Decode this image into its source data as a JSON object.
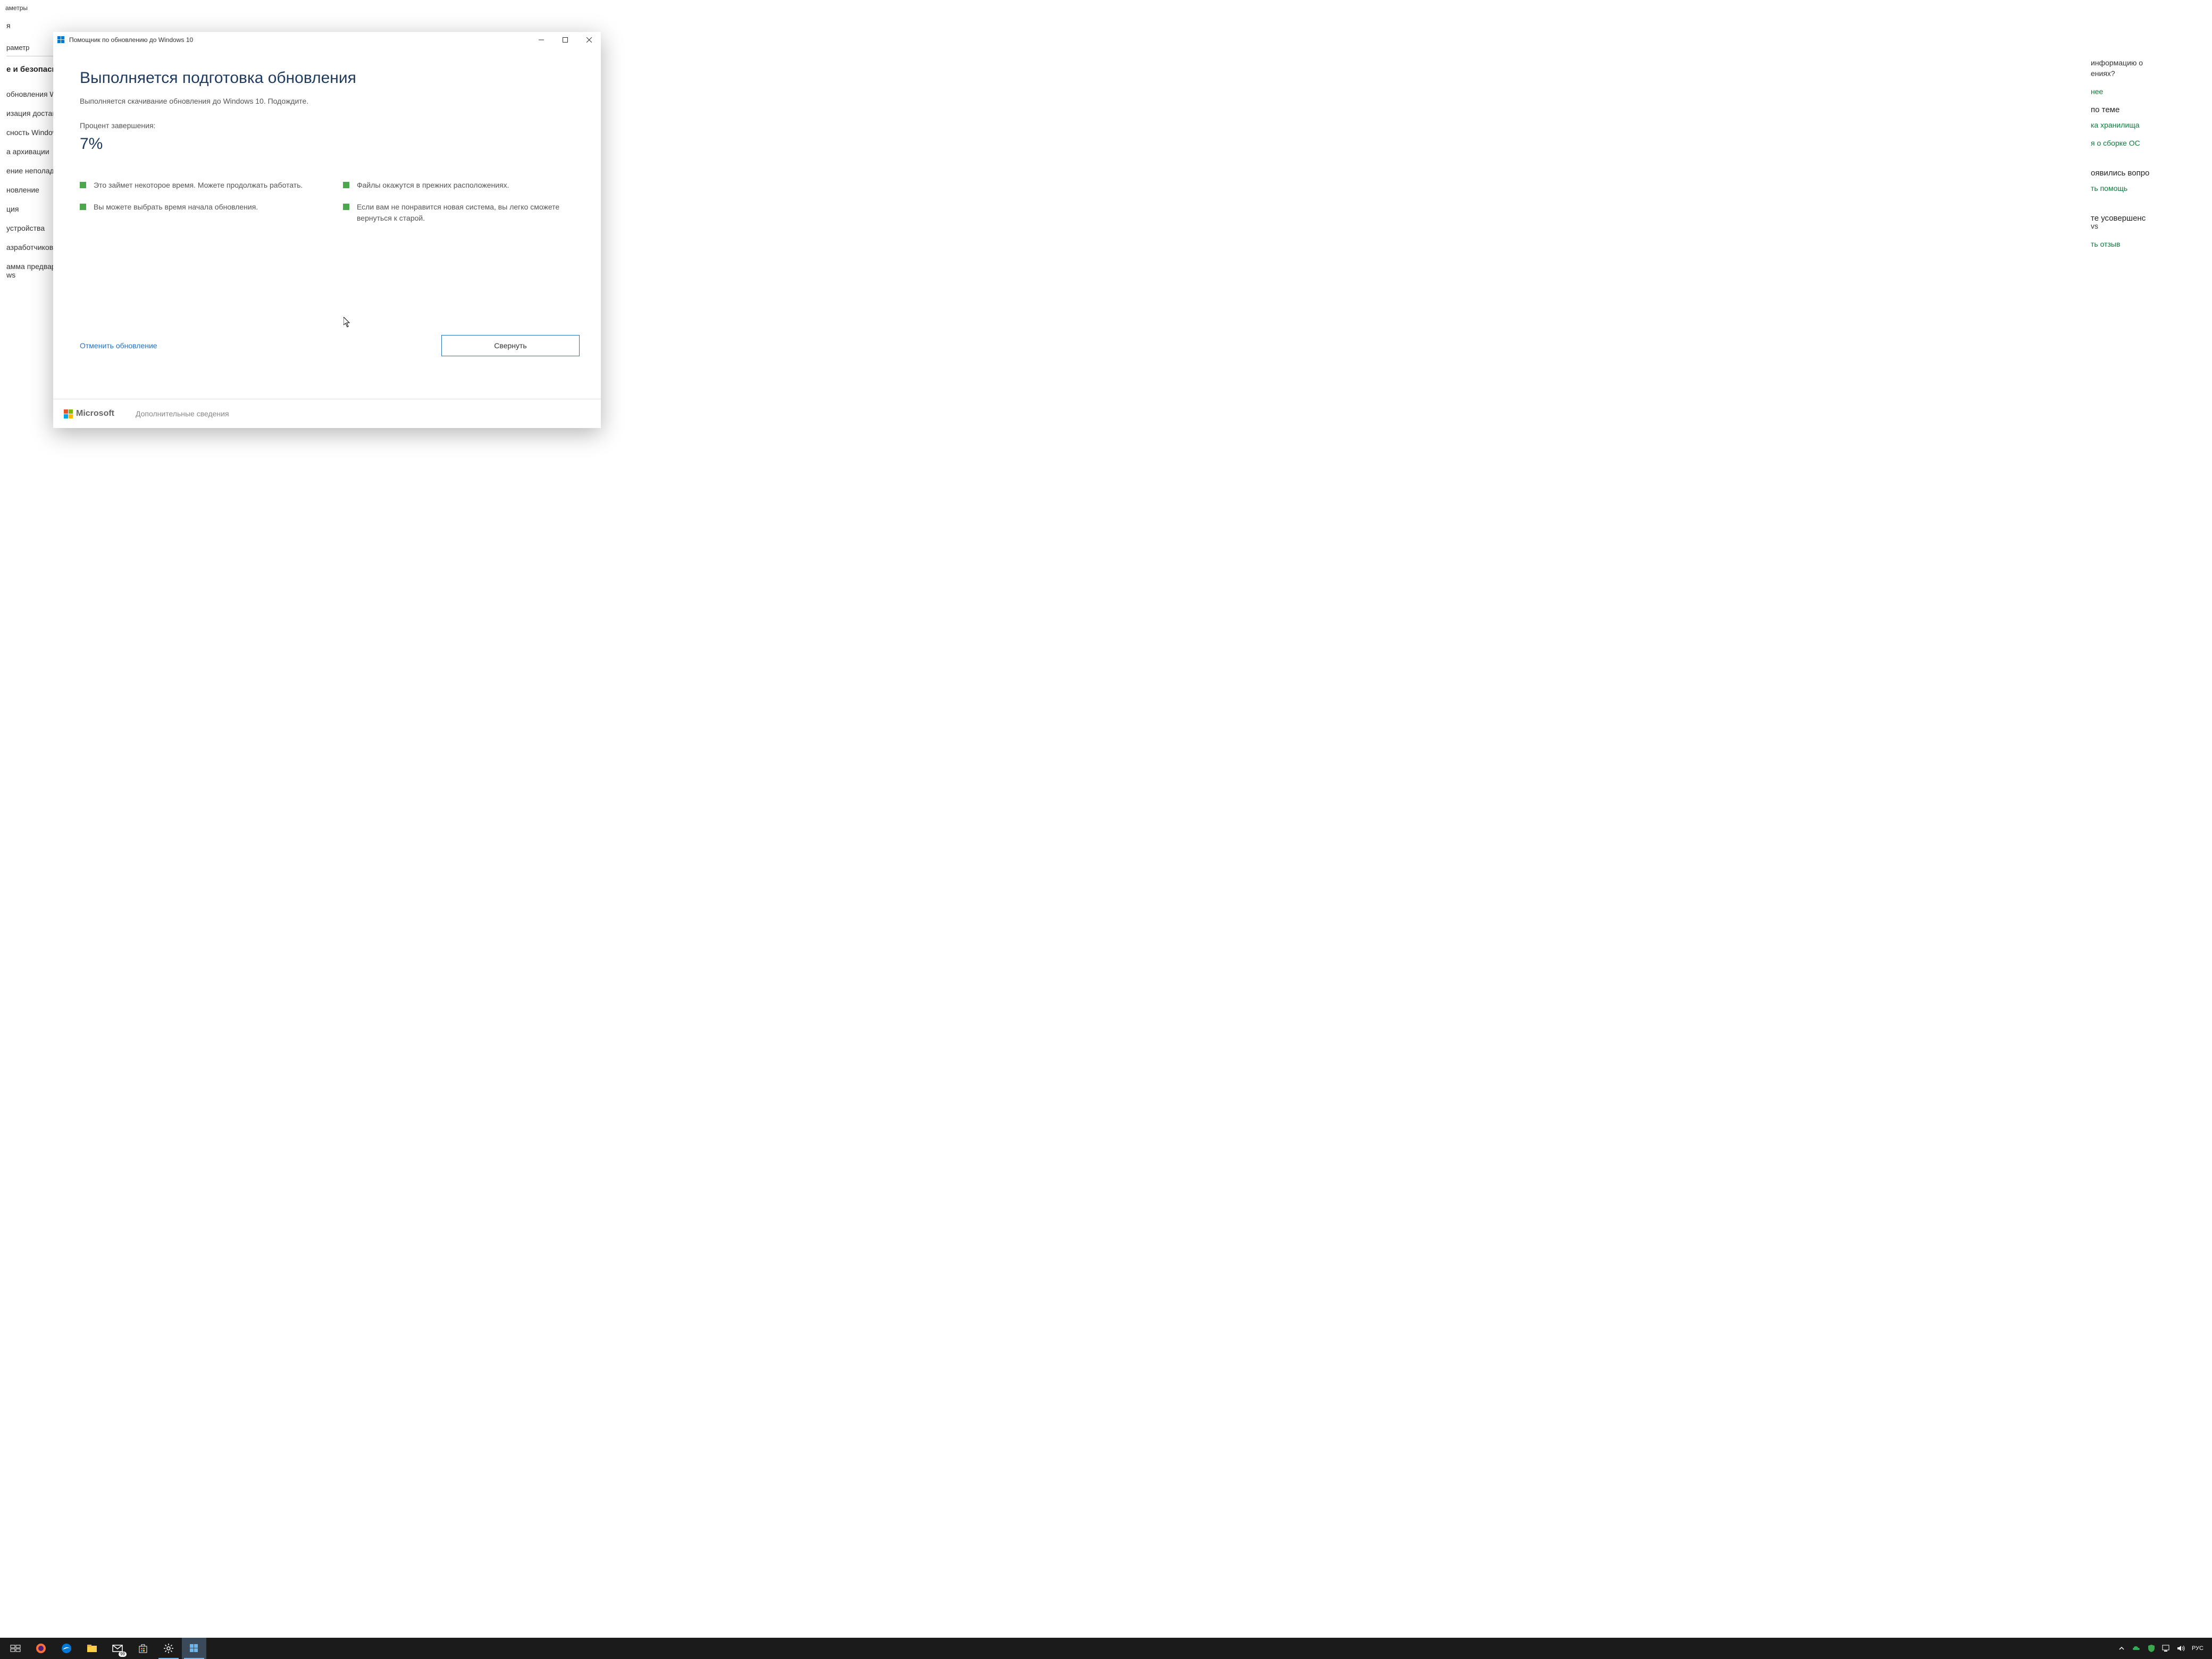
{
  "settings": {
    "app_title": "аметры",
    "home": "я",
    "search_label": "раметр",
    "section": "е и безопасно",
    "nav": [
      "обновления W",
      "изация достав",
      "сность Window",
      "а архивации",
      "ение неполад",
      "новление",
      "ция",
      "устройства",
      "азработчиков",
      "амма предвар\nws"
    ],
    "right": {
      "info1": "информацию о",
      "info2": "ениях?",
      "link1": "нее",
      "head1": "по теме",
      "link2": "ка хранилища",
      "link3": "я о сборке ОС",
      "q1": "оявились вопро",
      "link4": "ть помощь",
      "q2": "те усовершенс",
      "q3": "vs",
      "link5": "ть отзыв"
    }
  },
  "dialog": {
    "title": "Помощник по обновлению до Windows 10",
    "heading": "Выполняется подготовка обновления",
    "subtext": "Выполняется скачивание обновления до Windows 10. Подождите.",
    "percent_label": "Процент завершения:",
    "percent_value": "7%",
    "features": {
      "col1": [
        "Это займет некоторое время. Можете продолжать работать.",
        "Вы можете выбрать время начала обновления."
      ],
      "col2": [
        "Файлы окажутся в прежних расположениях.",
        "Если вам не понравится новая система, вы легко сможете вернуться к старой."
      ]
    },
    "cancel": "Отменить обновление",
    "minimize": "Свернуть",
    "ms_label": "Microsoft",
    "more_info": "Дополнительные сведения"
  },
  "taskbar": {
    "mail_badge": "99",
    "lang": "РУС"
  }
}
